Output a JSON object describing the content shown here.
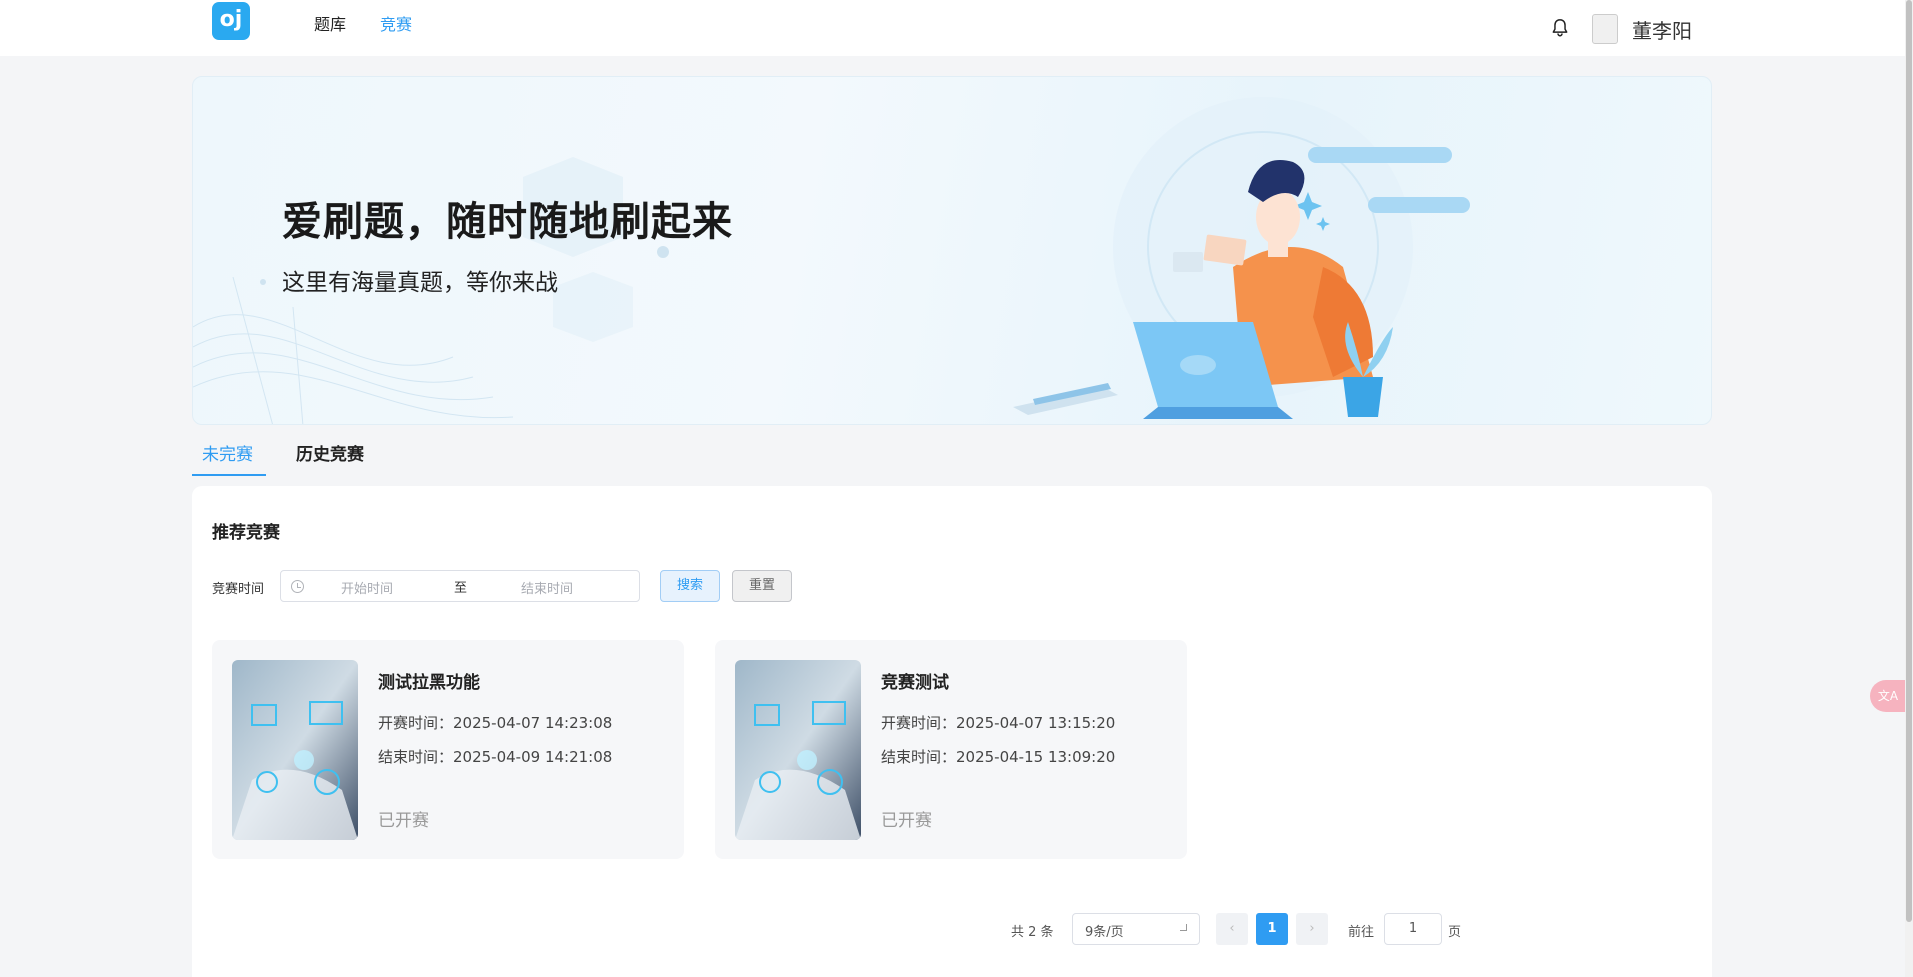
{
  "header": {
    "logo_text": "oj",
    "nav": [
      {
        "label": "题库",
        "active": false
      },
      {
        "label": "竞赛",
        "active": true
      }
    ],
    "username": "董李阳",
    "icons": {
      "notification": "bell-icon",
      "avatar": "avatar-broken-image"
    }
  },
  "banner": {
    "title": "爱刷题，随时随地刷起来",
    "subtitle": "这里有海量真题，等你来战"
  },
  "tabs": [
    {
      "label": "未完赛",
      "active": true
    },
    {
      "label": "历史竞赛",
      "active": false
    }
  ],
  "section": {
    "title": "推荐竞赛",
    "filter_label": "竞赛时间",
    "start_placeholder": "开始时间",
    "range_separator": "至",
    "end_placeholder": "结束时间",
    "search_label": "搜索",
    "reset_label": "重置"
  },
  "contests": [
    {
      "name": "测试拉黑功能",
      "start": "开赛时间：2025-04-07 14:23:08",
      "end": "结束时间：2025-04-09 14:21:08",
      "status": "已开赛"
    },
    {
      "name": "竞赛测试",
      "start": "开赛时间：2025-04-07 13:15:20",
      "end": "结束时间：2025-04-15 13:09:20",
      "status": "已开赛"
    }
  ],
  "pagination": {
    "total_text": "共 2 条",
    "page_size": "9条/页",
    "current_page": "1",
    "prev": "‹",
    "next": "›",
    "goto_prefix": "前往",
    "goto_value": "1",
    "goto_suffix": "页"
  },
  "colors": {
    "accent": "#2f9cf2",
    "background": "#f4f5f7",
    "card": "#f6f7f9"
  }
}
